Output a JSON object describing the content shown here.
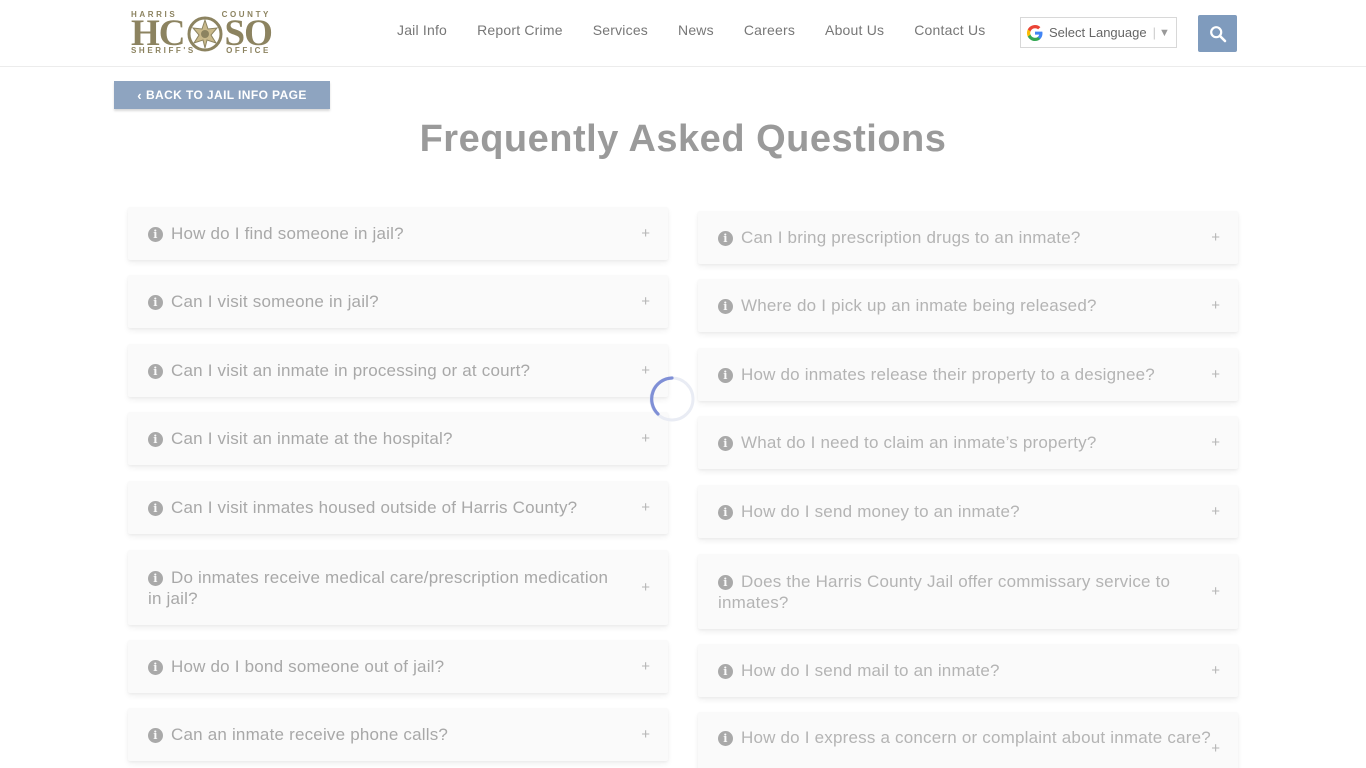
{
  "header": {
    "logo": {
      "top_text": "HARRIS COUNTY",
      "main_text_left": "HC",
      "main_text_right": "SO",
      "bottom_text": "SHERIFF'S OFFICE"
    },
    "nav": [
      "Jail Info",
      "Report Crime",
      "Services",
      "News",
      "Careers",
      "About Us",
      "Contact Us"
    ],
    "language_select": "Select Language",
    "search_icon": "search-icon"
  },
  "back_button": "BACK TO JAIL INFO PAGE",
  "page_title": "Frequently Asked Questions",
  "faq_left": [
    "How do I find someone in jail?",
    "Can I visit someone in jail?",
    "Can I visit an inmate in processing or at court?",
    "Can I visit an inmate at the hospital?",
    "Can I visit inmates housed outside of Harris County?",
    "Do inmates receive medical care/prescription medication in jail?",
    "How do I bond someone out of jail?",
    "Can an inmate receive phone calls?"
  ],
  "faq_right": [
    "Can I bring prescription drugs to an inmate?",
    "Where do I pick up an inmate being released?",
    "How do inmates release their property to a designee?",
    "What do I need to claim an inmate’s property?",
    "How do I send money to an inmate?",
    "Does the Harris County Jail offer commissary service to inmates?",
    "How do I send mail to an inmate?",
    "How do I express a concern or complaint about inmate care?"
  ],
  "expand_symbol": "+",
  "colors": {
    "accent": "#8ea4c0",
    "search_bg": "#7f9bbd",
    "logo": "#8c8360",
    "spinner": "#7f8fd6"
  }
}
